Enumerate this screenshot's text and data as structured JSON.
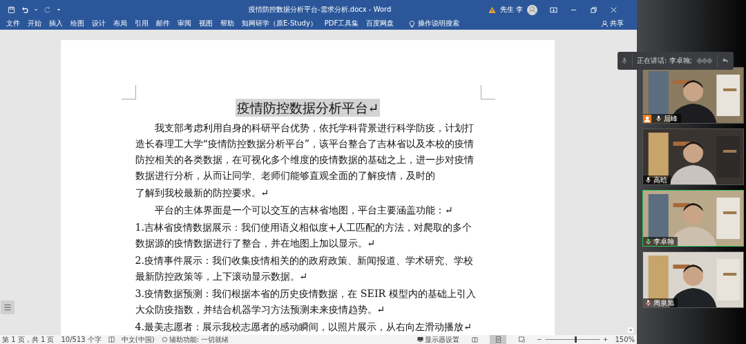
{
  "title_bar": {
    "title": "疫情防控数据分析平台-需求分析.docx - Word",
    "user": "先生 李",
    "redo_disabled": true
  },
  "ribbon_tabs": [
    {
      "label": "文件"
    },
    {
      "label": "开始"
    },
    {
      "label": "插入"
    },
    {
      "label": "绘图"
    },
    {
      "label": "设计"
    },
    {
      "label": "布局"
    },
    {
      "label": "引用"
    },
    {
      "label": "邮件"
    },
    {
      "label": "审阅"
    },
    {
      "label": "视图"
    },
    {
      "label": "帮助"
    },
    {
      "label": "知网研学（原E-Study）"
    },
    {
      "label": "PDF工具集"
    },
    {
      "label": "百度网盘"
    }
  ],
  "tell_me": "操作说明搜索",
  "share": "共享",
  "document": {
    "title": "疫情防控数据分析平台↵",
    "paragraphs": [
      {
        "kind": "indent",
        "text": "我支部考虑利用自身的科研平台优势，依托学科背景进行科学防疫，计划打造长春理工大学“疫情防控数据分析平台”，该平台整合了吉林省以及本校的疫情防控相关的各类数据，在可视化多个维度的疫情数据的基础之上，进一步对疫情数据进行分析，从而让同学、老师们能够直观全面的了解疫情，及时的"
      },
      {
        "kind": "plain",
        "text": "了解到我校最新的防控要求。↵"
      },
      {
        "kind": "indent",
        "text": "平台的主体界面是一个可以交互的吉林省地图，平台主要涵盖功能：↵"
      },
      {
        "kind": "plain",
        "text": "1.吉林省疫情数据展示：我们使用语义相似度+人工匹配的方法，对爬取的多个数据源的疫情数据进行了整合，并在地图上加以显示。↵"
      },
      {
        "kind": "plain",
        "text": "2.疫情事件展示：我们收集疫情相关的的政府政策、新闻报道、学术研究、学校最新防控政策等，上下滚动显示数据。↵"
      },
      {
        "kind": "plain",
        "text": "3.疫情数据预测：我们根据本省的历史疫情数据，在 SEIR 模型内的基础上引入大众防疫指数，并结合机器学习方法预测未来疫情趋势。↵"
      },
      {
        "kind": "plain",
        "text": "4.最美志愿者：展示我校志愿者的感动瞬间，以照片展示，从右向左滑动播放↵"
      }
    ]
  },
  "status_bar": {
    "page": "第 1 页，共 1 页",
    "words": "10/513 个字",
    "language": "中文(中国)",
    "accessibility": "辅助功能: 一切就绪",
    "display": "显示器设置",
    "views": [
      {
        "kind": "read",
        "selected": false
      },
      {
        "kind": "print",
        "selected": true
      },
      {
        "kind": "web",
        "selected": false
      }
    ],
    "zoom": {
      "out": "−",
      "in": "+",
      "level": 0.54,
      "reading": "150%"
    }
  },
  "meeting": {
    "speaking_label": "正在讲话: 李卓翰;",
    "participants": [
      {
        "name": "屈峰",
        "host": true,
        "speaking": false,
        "muted": false
      },
      {
        "name": "高晗",
        "host": false,
        "speaking": false,
        "muted": false
      },
      {
        "name": "李卓翰",
        "host": false,
        "speaking": true,
        "muted": false
      },
      {
        "name": "周泉旭",
        "host": false,
        "speaking": false,
        "muted": true
      }
    ]
  }
}
